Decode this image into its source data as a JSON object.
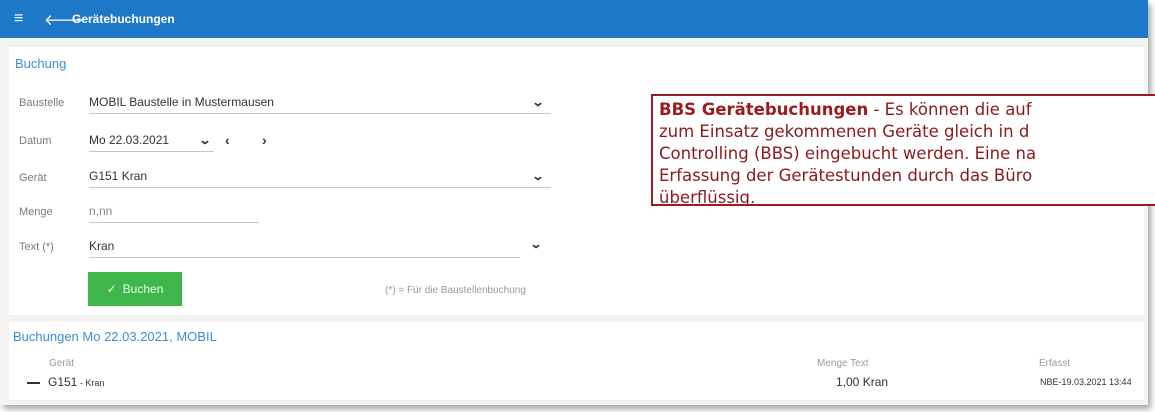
{
  "header": {
    "title": "Gerätebuchungen",
    "menu_icon": "hamburger-icon",
    "back_icon": "arrow-left-icon",
    "color": "#1e78c8"
  },
  "form": {
    "section_title": "Buchung",
    "baustelle": {
      "label": "Baustelle",
      "value": "MOBIL   Baustelle in Mustermausen"
    },
    "datum": {
      "label": "Datum",
      "value": "Mo 22.03.2021"
    },
    "geraet": {
      "label": "Gerät",
      "value": "G151   Kran"
    },
    "menge": {
      "label": "Menge",
      "placeholder": "n,nn"
    },
    "text": {
      "label": "Text (*)",
      "value": "Kran"
    },
    "buchen_button": "Buchen",
    "hint": "(*) = Für die Baustellenbuchung"
  },
  "callout": {
    "title": "BBS Gerätebuchungen",
    "line1": " - Es können die auf",
    "line2": "zum Einsatz gekommenen Geräte gleich in d",
    "line3": "Controlling (BBS) eingebucht werden. Eine na",
    "line4": "Erfassung der Gerätestunden durch das Büro",
    "line5": "überflüssig.",
    "border_color": "#9c1b1f"
  },
  "bookings": {
    "section_title": "Buchungen Mo 22.03.2021, MOBIL",
    "columns": {
      "geraet": "Gerät",
      "menge_text": "Menge Text",
      "erfasst": "Erfasst"
    },
    "rows": [
      {
        "code": "G151",
        "name": " - Kran",
        "menge": "1,00",
        "text": "Kran",
        "erfasst": "NBE-19.03.2021 13:44"
      }
    ]
  },
  "accent_green": "#3fb649"
}
